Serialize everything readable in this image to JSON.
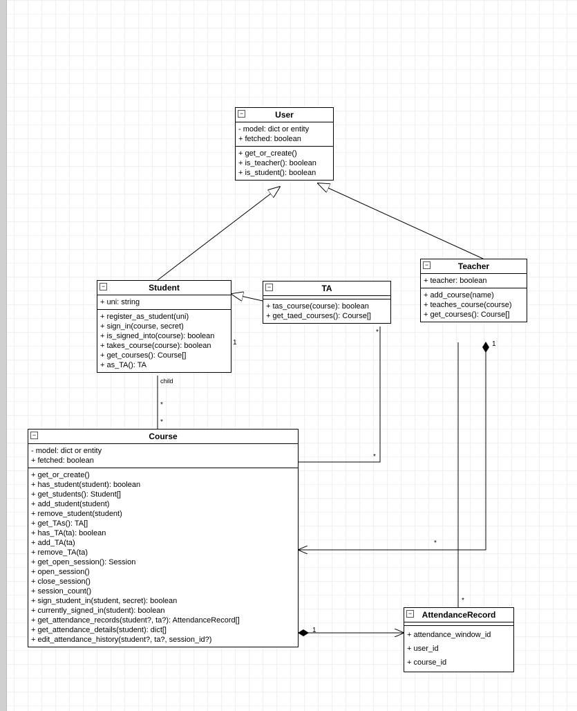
{
  "classes": {
    "user": {
      "name": "User",
      "attrs": [
        "- model: dict or entity",
        "+ fetched: boolean"
      ],
      "ops": [
        "+ get_or_create()",
        "+ is_teacher(): boolean",
        "+ is_student(): boolean"
      ]
    },
    "student": {
      "name": "Student",
      "attrs": [
        "+ uni: string"
      ],
      "ops": [
        "+ register_as_student(uni)",
        "+ sign_in(course, secret)",
        "+ is_signed_into(course): boolean",
        "+ takes_course(course): boolean",
        "+ get_courses(): Course[]",
        "+ as_TA(): TA"
      ]
    },
    "ta": {
      "name": "TA",
      "attrs": [],
      "ops": [
        "+ tas_course(course): boolean",
        "+ get_taed_courses(): Course[]"
      ]
    },
    "teacher": {
      "name": "Teacher",
      "attrs": [
        "+ teacher: boolean"
      ],
      "ops": [
        "+ add_course(name)",
        "+ teaches_course(course)",
        "+ get_courses(): Course[]"
      ]
    },
    "course": {
      "name": "Course",
      "attrs": [
        "- model: dict or entity",
        "+ fetched: boolean"
      ],
      "ops": [
        "+ get_or_create()",
        "+ has_student(student): boolean",
        "+ get_students(): Student[]",
        "+ add_student(student)",
        "+ remove_student(student)",
        "+ get_TAs(): TA[]",
        "+ has_TA(ta): boolean",
        "+ add_TA(ta)",
        "+ remove_TA(ta)",
        "+ get_open_session(): Session",
        "+ open_session()",
        "+ close_session()",
        "+ session_count()",
        "+ sign_student_in(student, secret): boolean",
        "+ currently_signed_in(student): boolean",
        "+ get_attendance_records(student?, ta?): AttendanceRecord[]",
        "+ get_attendance_details(student): dict[]",
        "+ edit_attendance_history(student?, ta?, session_id?)"
      ]
    },
    "attendance": {
      "name": "AttendanceRecord",
      "attrs": [],
      "ops": [
        "+ attendance_window_id",
        "+ user_id",
        "+ course_id"
      ]
    }
  },
  "labels": {
    "child": "child",
    "one_a": "1",
    "one_b": "1",
    "one_c": "1",
    "star_a": "*",
    "star_b": "*",
    "star_c": "*",
    "star_d": "*",
    "star_e": "*",
    "star_f": "*"
  }
}
